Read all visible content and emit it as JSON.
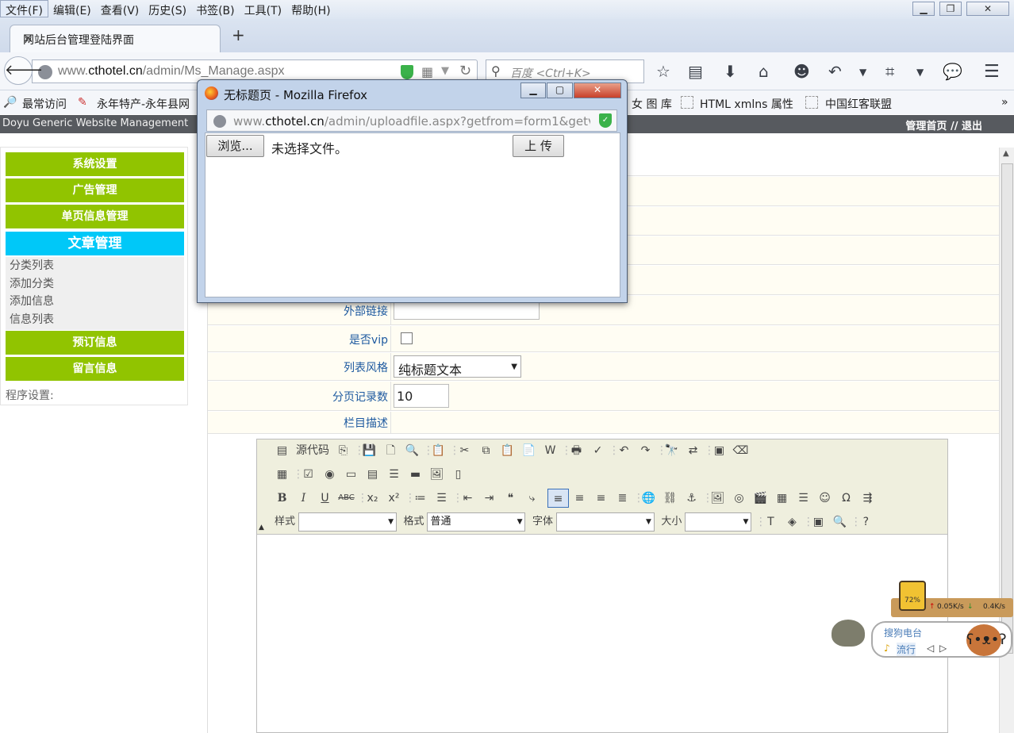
{
  "menubar": {
    "items": [
      "文件(F)",
      "编辑(E)",
      "查看(V)",
      "历史(S)",
      "书签(B)",
      "工具(T)",
      "帮助(H)"
    ]
  },
  "tab": {
    "title": "网站后台管理登陆界面",
    "close": "×",
    "new_tab": "+"
  },
  "nav": {
    "url_host": "www.",
    "url_domain": "cthotel.cn",
    "url_path": "/admin/Ms_Manage.aspx",
    "search_placeholder": "百度 <Ctrl+K>"
  },
  "bookmarks": {
    "items": [
      "最常访问",
      "永年特产-永年县网",
      "女 图 库",
      "HTML xmlns 属性",
      "中国红客联盟"
    ],
    "more": "»"
  },
  "admin_header": {
    "title": "Doyu Generic Website Management",
    "home": "管理首页",
    "sep": " // ",
    "logout": "退出"
  },
  "sidebar": {
    "buttons": [
      "系统设置",
      "广告管理",
      "单页信息管理"
    ],
    "active_section": "文章管理",
    "sub_items": [
      "分类列表",
      "添加分类",
      "添加信息",
      "信息列表"
    ],
    "buttons_after": [
      "预订信息",
      "留言信息"
    ],
    "program_settings": "程序设置:"
  },
  "form": {
    "external_link_label": "外部链接",
    "vip_label": "是否vip",
    "list_style_label": "列表风格",
    "list_style_value": "纯标题文本",
    "page_size_label": "分页记录数",
    "page_size_value": "10",
    "description_label": "栏目描述"
  },
  "editor": {
    "source_label": "源代码",
    "style_label": "样式",
    "format_label": "格式",
    "format_value": "普通",
    "font_label": "字体",
    "size_label": "大小"
  },
  "popup": {
    "title": "无标题页 - Mozilla Firefox",
    "url_host": "www.",
    "url_domain": "cthotel.cn",
    "url_path": "/admin/uploadfile.aspx?getfrom=form1&getv",
    "browse": "浏览...",
    "no_file": "未选择文件。",
    "upload": "上 传"
  },
  "widgets": {
    "lamp_percent": "72%",
    "upload_speed": "0.05K/s",
    "download_speed": "0.4K/s",
    "radio_title": "搜狗电台",
    "radio_channel": "流行"
  },
  "colors": {
    "sidebar_button": "#91c400",
    "sidebar_active": "#00c8f8",
    "header_bar": "#575a5f",
    "form_label": "#1e5aa0"
  }
}
